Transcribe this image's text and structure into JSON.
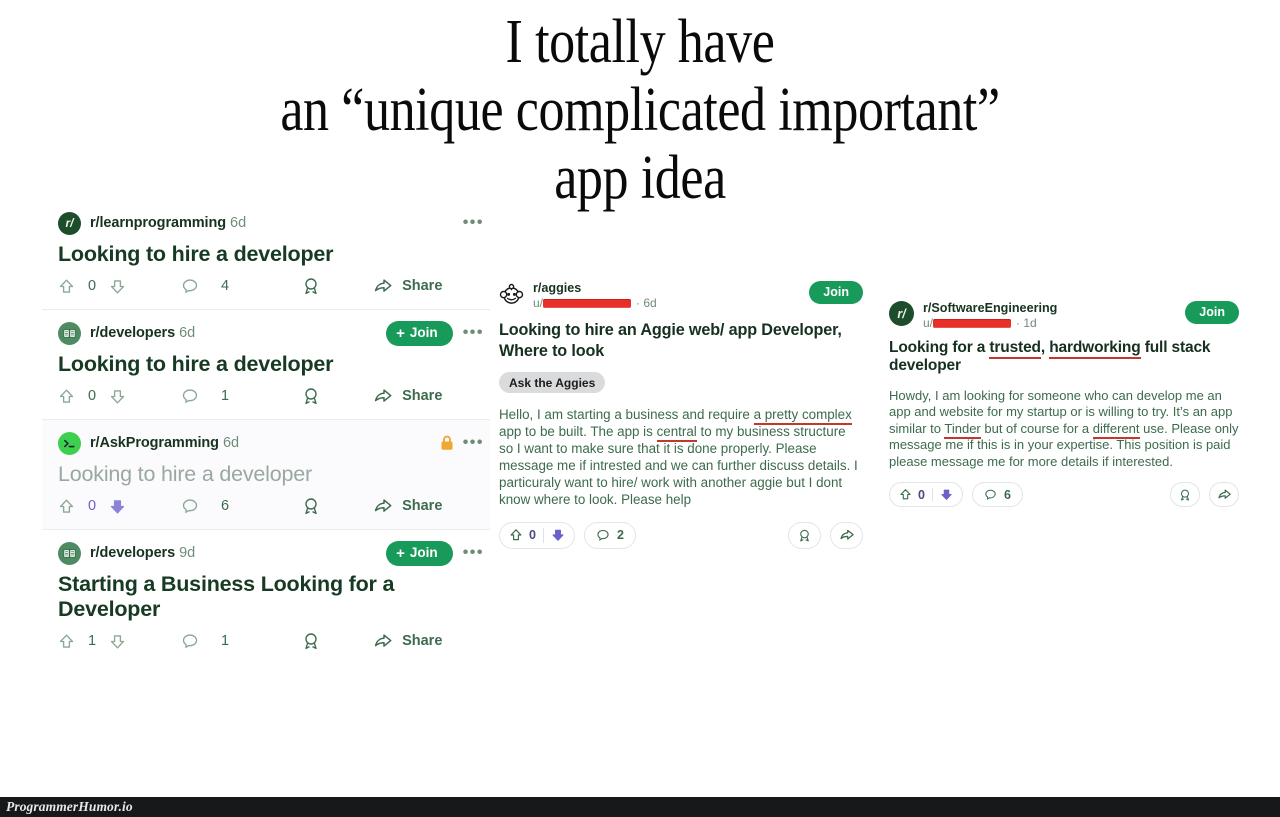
{
  "meme": {
    "caption": "I totally have\nan “unique complicated important”\napp idea",
    "watermark": "ProgrammerHumor.io"
  },
  "colors": {
    "join_green": "#189b5a",
    "reddit_text_green": "#3e6b4e",
    "title_green": "#173a22",
    "downvote_purple": "#6b61c9",
    "lock_orange": "#f0a830",
    "redaction_red": "#e8302a",
    "spellcheck_underline": "#c0392b",
    "watermark_bar": "#17181a"
  },
  "left_column": {
    "posts": [
      {
        "subreddit": "r/learnprogramming",
        "age": "6d",
        "avatar": "reddit-r-slash-icon",
        "title": "Looking to hire a developer",
        "score": "0",
        "comments": "4",
        "share_label": "Share",
        "has_join": false,
        "joined_label": "",
        "locked": false,
        "downvoted": false
      },
      {
        "subreddit": "r/developers",
        "age": "6d",
        "avatar": "book-icon",
        "title": "Looking to hire a developer",
        "score": "0",
        "comments": "1",
        "share_label": "Share",
        "has_join": true,
        "joined_label": "Join",
        "locked": false,
        "downvoted": false
      },
      {
        "subreddit": "r/AskProgramming",
        "age": "6d",
        "avatar": "terminal-icon",
        "title": "Looking to hire a developer",
        "score": "0",
        "comments": "6",
        "share_label": "Share",
        "has_join": false,
        "joined_label": "",
        "locked": true,
        "downvoted": true
      },
      {
        "subreddit": "r/developers",
        "age": "9d",
        "avatar": "book-icon",
        "title": "Starting a Business Looking for a Developer",
        "score": "1",
        "comments": "1",
        "share_label": "Share",
        "has_join": true,
        "joined_label": "Join",
        "locked": false,
        "downvoted": false
      }
    ]
  },
  "middle_card": {
    "subreddit": "r/aggies",
    "avatar": "snoo-icon",
    "username_prefix": "u/",
    "username_redacted": true,
    "age": "6d",
    "join_label": "Join",
    "title": "Looking to hire an Aggie web/ app Developer, Where to look",
    "flair": "Ask the Aggies",
    "body_segments": [
      {
        "text": "Hello, I am starting a business and require ",
        "underline": false
      },
      {
        "text": "a pretty complex",
        "underline": true
      },
      {
        "text": " app to be built. The app is ",
        "underline": false
      },
      {
        "text": "central",
        "underline": true
      },
      {
        "text": " to my business structure so I want to make sure that it is done properly. Please message me if intrested and we can further discuss details. I particuraly want to hire/ work with another aggie but I dont know where to look. Please help",
        "underline": false
      }
    ],
    "score": "0",
    "comments": "2",
    "downvoted": true
  },
  "right_card": {
    "subreddit": "r/SoftwareEngineering",
    "avatar": "reddit-r-slash-icon",
    "username_prefix": "u/",
    "username_redacted": true,
    "age": "1d",
    "join_label": "Join",
    "title_segments": [
      {
        "text": "Looking for a ",
        "underline": false
      },
      {
        "text": "trusted",
        "underline": true
      },
      {
        "text": ", ",
        "underline": false
      },
      {
        "text": "hardworking",
        "underline": true
      },
      {
        "text": " full stack developer",
        "underline": false
      }
    ],
    "body_segments": [
      {
        "text": "Howdy, I am looking for someone who can develop me an app and website for my startup or is willing to try. It’s an app similar to ",
        "underline": false
      },
      {
        "text": "Tinder",
        "underline": true
      },
      {
        "text": " but of course for a ",
        "underline": false
      },
      {
        "text": "different",
        "underline": true
      },
      {
        "text": " use. Please only message me if this is in your expertise. This position is paid please message me for more details if interested.",
        "underline": false
      }
    ],
    "score": "0",
    "comments": "6",
    "downvoted": true
  }
}
